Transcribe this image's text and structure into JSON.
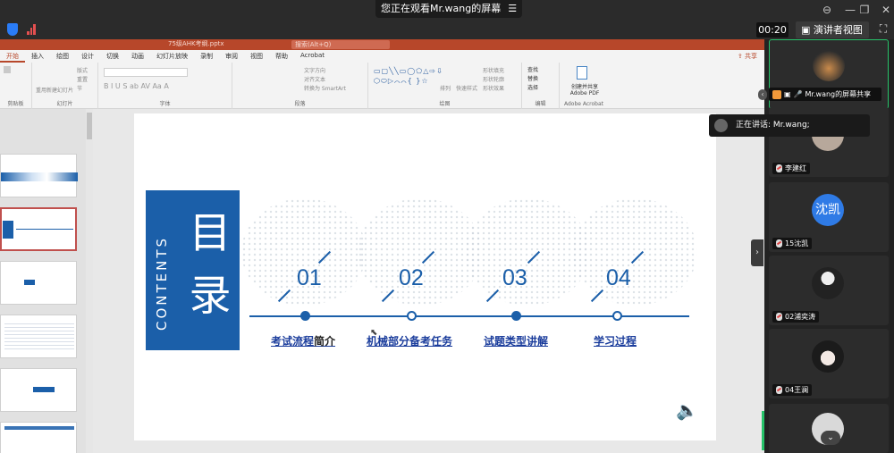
{
  "meeting": {
    "watch_banner": "您正在观看Mr.wang的屏幕",
    "timer": "00:20",
    "presenter_view_label": "演讲者视图",
    "share_label": "Mr.wang的屏幕共享",
    "speaking_label": "正在讲话: Mr.wang;"
  },
  "ppt": {
    "file_title": "75级AHK考纲.pptx",
    "search_placeholder": "搜索(Alt+Q)",
    "menu": [
      "开始",
      "插入",
      "绘图",
      "设计",
      "切换",
      "动画",
      "幻灯片放映",
      "录制",
      "审阅",
      "视图",
      "帮助",
      "Acrobat"
    ],
    "share_button": "共享",
    "ribbon": {
      "clipboard": "剪贴板",
      "slides_group": "幻灯片",
      "new_slide": "新建幻灯片",
      "reuse": "重用",
      "layout": "版式",
      "reset": "重置",
      "section": "节",
      "font_group": "字体",
      "paragraph_group": "段落",
      "text_direction": "文字方向",
      "align_text": "对齐文本",
      "smartart": "转换为 SmartArt",
      "drawing_group": "绘图",
      "arrange": "排列",
      "quick_styles": "快速样式",
      "shape_fill": "形状填充",
      "shape_outline": "形状轮廓",
      "shape_effects": "形状效果",
      "editing_group": "编辑",
      "find": "查找",
      "replace": "替换",
      "select": "选择",
      "acrobat_group": "Adobe Acrobat",
      "create_pdf": "创建并共享 Adobe PDF"
    }
  },
  "slide": {
    "contents": "CONTENTS",
    "mulu_1": "目",
    "mulu_2": "录",
    "items": [
      {
        "num": "01",
        "label_link": "考试流程",
        "label_plain": "简介"
      },
      {
        "num": "02",
        "label_link": "机械部分备考任务",
        "label_plain": ""
      },
      {
        "num": "03",
        "label_link": "试题类型讲解",
        "label_plain": ""
      },
      {
        "num": "04",
        "label_link": "学习过程",
        "label_plain": ""
      }
    ]
  },
  "participants": [
    {
      "name": "李建红"
    },
    {
      "name": "15沈凯",
      "avatar_text": "沈凯"
    },
    {
      "name": "02浦奕涛"
    },
    {
      "name": "04王澜"
    }
  ],
  "colors": {
    "accent_blue": "#1b5fa9",
    "ppt_red": "#b7472a",
    "active_green": "#27c36a"
  }
}
